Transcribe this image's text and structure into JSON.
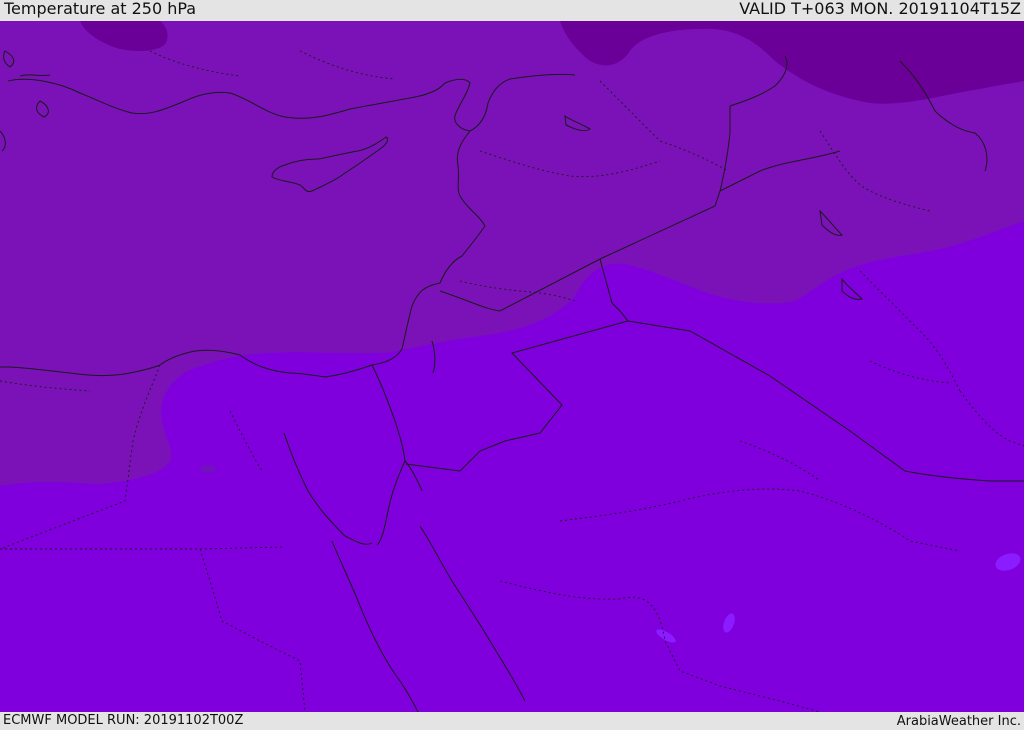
{
  "header": {
    "title": "Temperature at 250 hPa",
    "valid": "VALID T+063 MON. 20191104T15Z"
  },
  "footer": {
    "model_run": "ECMWF MODEL RUN: 20191102T00Z",
    "credit": "ArabiaWeather Inc."
  },
  "map": {
    "field": "temperature",
    "level": "250 hPa",
    "colors": {
      "warm_band": "#7f00dd",
      "mid_band": "#7a12b8",
      "cold_band": "#6a0097",
      "coast_and_borders": "#1a1a1a"
    }
  }
}
